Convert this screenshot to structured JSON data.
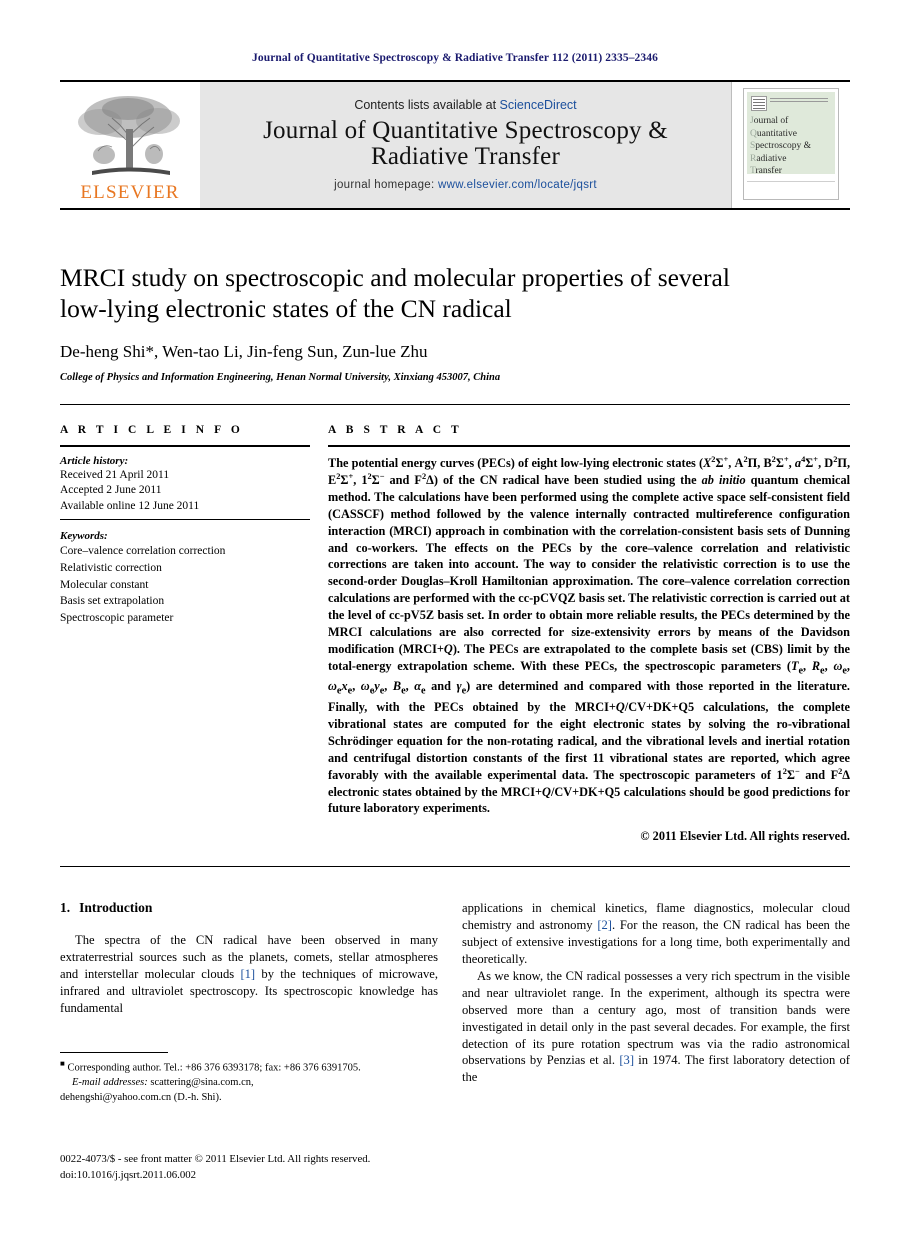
{
  "running_head": "Journal of Quantitative Spectroscopy & Radiative Transfer 112 (2011) 2335–2346",
  "banner": {
    "contents_prefix": "Contents lists available at ",
    "sciencedirect": "ScienceDirect",
    "journal_title_line1": "Journal of Quantitative Spectroscopy &",
    "journal_title_line2": "Radiative Transfer",
    "homepage_prefix": "journal homepage: ",
    "homepage_url": "www.elsevier.com/locate/jqsrt",
    "publisher_wordmark": "ELSEVIER",
    "cover_title_lines": [
      "ournal of",
      "uantitative",
      "pectroscopy &",
      "adiative",
      "ransfer"
    ],
    "cover_title_initials": [
      "J",
      "Q",
      "S",
      "R",
      "T"
    ]
  },
  "article": {
    "title_line1": "MRCI study on spectroscopic and molecular properties of several",
    "title_line2": "low-lying electronic states of the CN radical",
    "authors": "De-heng Shi*, Wen-tao Li, Jin-feng Sun, Zun-lue Zhu",
    "affiliation": "College of Physics and Information Engineering, Henan Normal University, Xinxiang 453007, China"
  },
  "article_info": {
    "heading": "A R T I C L E   I N F O",
    "history_label": "Article history:",
    "history": [
      "Received 21 April 2011",
      "Accepted 2 June 2011",
      "Available online 12 June 2011"
    ],
    "keywords_label": "Keywords:",
    "keywords": [
      "Core–valence correlation correction",
      "Relativistic correction",
      "Molecular constant",
      "Basis set extrapolation",
      "Spectroscopic parameter"
    ]
  },
  "abstract": {
    "heading": "A B S T R A C T",
    "copyright": "© 2011 Elsevier Ltd. All rights reserved."
  },
  "introduction": {
    "number": "1.",
    "heading": "Introduction"
  },
  "footnote": {
    "corresponding": "Corresponding author. Tel.: +86 376 6393178; fax: +86 376 6391705.",
    "email_label": "E-mail addresses:",
    "email1": " scattering@sina.com.cn,",
    "email2": "dehengshi@yahoo.com.cn (D.-h. Shi)."
  },
  "footer": {
    "line1": "0022-4073/$ - see front matter © 2011 Elsevier Ltd. All rights reserved.",
    "line2": "doi:10.1016/j.jqsrt.2011.06.002"
  },
  "colors": {
    "link": "#1b4f9c",
    "running_head": "#1a1a6e",
    "elsevier_orange": "#E87722",
    "banner_grey": "#e6e6e6",
    "cover_green": "#dfe9da"
  }
}
